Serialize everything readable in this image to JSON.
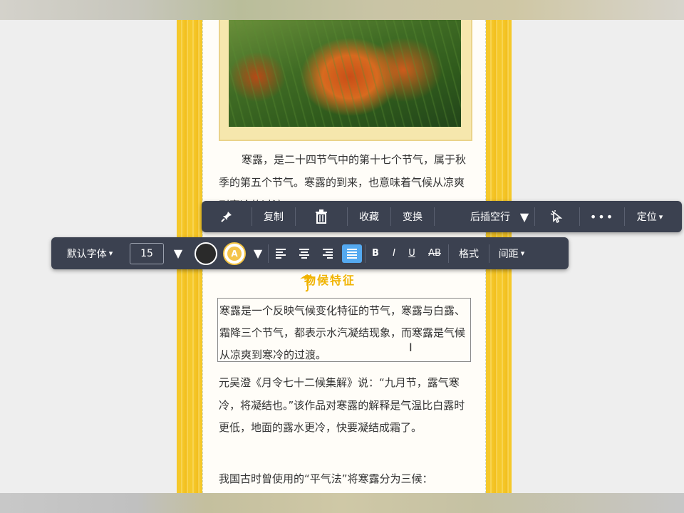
{
  "article": {
    "para1": "寒露，是二十四节气中的第十七个节气，属于秋季的第五个节气。寒露的到来，也意味着气候从凉爽到寒冷的过渡。",
    "section_title": "物候特征",
    "boxed_text": "寒露是一个反映气候变化特征的节气，寒露与白露、霜降三个节气，都表示水汽凝结现象，而寒露是气候从凉爽到寒冷的过渡。",
    "para2": "元吴澄《月令七十二候集解》说：“九月节，露气寒冷，将凝结也。”该作品对寒露的解释是气温比白露时更低，地面的露水更冷，快要凝结成霜了。",
    "para3": "我国古时曾使用的“平气法”将寒露分为三候："
  },
  "toolbar_top": {
    "copy": "复制",
    "collect": "收藏",
    "transform": "变换",
    "insert_blank_after": "后插空行",
    "locate": "定位",
    "more": "•••",
    "icons": [
      "pin-icon",
      "trash-icon",
      "cursor-icon"
    ]
  },
  "toolbar_format": {
    "font": "默认字体",
    "font_size": "15",
    "text_color": "#2a2a2a",
    "highlight_label": "A",
    "bold": "B",
    "italic": "I",
    "underline": "U",
    "strike": "AB",
    "style": "格式",
    "spacing": "间距",
    "active_alignment": "justify",
    "accent_color": "#54a9f0"
  },
  "theme": {
    "stripe_color": "#f5c82a",
    "title_color": "#f0b300"
  }
}
